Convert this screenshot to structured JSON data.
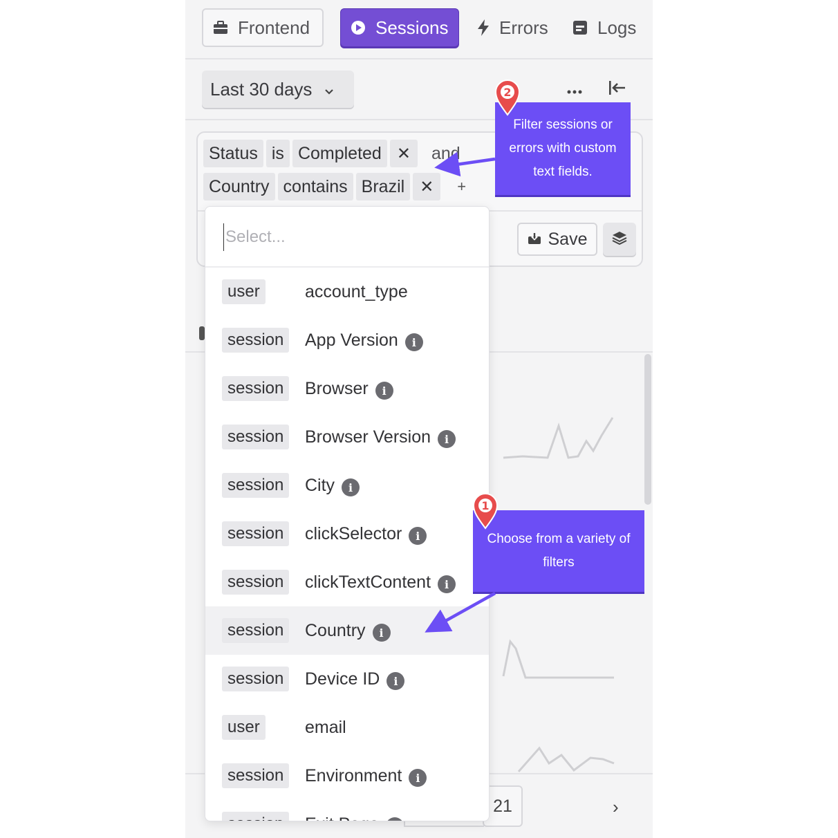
{
  "tabs": [
    {
      "label": "Frontend",
      "icon": "briefcase-icon"
    },
    {
      "label": "Sessions",
      "icon": "play-circle-icon",
      "active": true
    },
    {
      "label": "Errors",
      "icon": "lightning-icon"
    },
    {
      "label": "Logs",
      "icon": "log-icon"
    }
  ],
  "date_range": {
    "label": "Last 30 days"
  },
  "filters": {
    "row1": {
      "field": "Status",
      "op": "is",
      "value": "Completed",
      "remove": "✕",
      "joiner": "and"
    },
    "row2": {
      "field": "Country",
      "op": "contains",
      "value": "Brazil",
      "remove": "✕",
      "add": "+"
    }
  },
  "actions": {
    "save_label": "Save"
  },
  "dropdown": {
    "placeholder": "Select...",
    "options": [
      {
        "tag": "user",
        "label": "account_type",
        "info": false
      },
      {
        "tag": "session",
        "label": "App Version",
        "info": true
      },
      {
        "tag": "session",
        "label": "Browser",
        "info": true
      },
      {
        "tag": "session",
        "label": "Browser Version",
        "info": true
      },
      {
        "tag": "session",
        "label": "City",
        "info": true
      },
      {
        "tag": "session",
        "label": "clickSelector",
        "info": true
      },
      {
        "tag": "session",
        "label": "clickTextContent",
        "info": true
      },
      {
        "tag": "session",
        "label": "Country",
        "info": true,
        "highlighted": true
      },
      {
        "tag": "session",
        "label": "Device ID",
        "info": true
      },
      {
        "tag": "user",
        "label": "email",
        "info": false
      },
      {
        "tag": "session",
        "label": "Environment",
        "info": true
      },
      {
        "tag": "session",
        "label": "Exit Page",
        "info": true
      }
    ]
  },
  "pager": {
    "page": "21",
    "next": "›"
  },
  "callouts": [
    {
      "number": "2",
      "text_lines": [
        "Filter sessions or",
        "errors with custom",
        "text fields."
      ]
    },
    {
      "number": "1",
      "text_lines": [
        "Choose from a variety of",
        "filters"
      ]
    }
  ],
  "colors": {
    "accent": "#744ed4",
    "callout": "#6c4ef5",
    "pin": "#e74c4c"
  }
}
